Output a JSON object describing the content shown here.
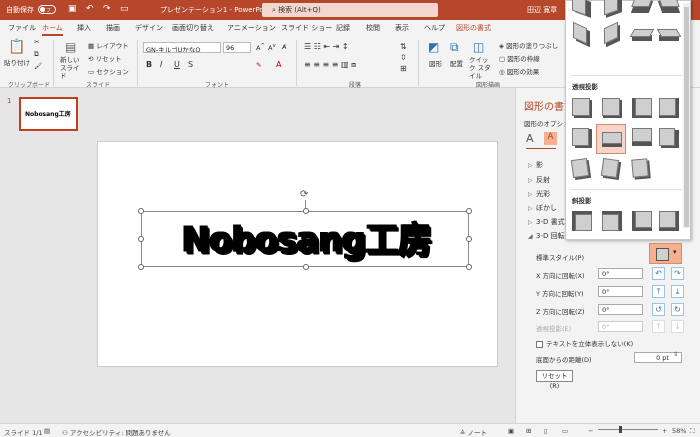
{
  "titlebar": {
    "autosave_label": "自動保存",
    "autosave_state": "オフ",
    "doc_title": "プレゼンテーション1 - PowerPoint",
    "search_placeholder": "検索 (Alt+Q)",
    "user_name": "田辺 寛章",
    "accent_color": "#b7472a"
  },
  "tabs": [
    "ファイル",
    "ホーム",
    "挿入",
    "描画",
    "デザイン",
    "画面切り替え",
    "アニメーション",
    "スライド ショー",
    "記録",
    "校閲",
    "表示",
    "ヘルプ",
    "図形の書式"
  ],
  "active_tab": "ホーム",
  "ribbon": {
    "clipboard": {
      "paste": "貼り付け",
      "group": "クリップボード"
    },
    "slides": {
      "new_slide": "新しい スライド",
      "layout": "レイアウト",
      "reset": "リセット",
      "section": "セクション",
      "group": "スライド"
    },
    "font": {
      "font_name": "GN-キルゴUかなO",
      "font_size": "96",
      "group": "フォント",
      "bold": "B",
      "italic": "I",
      "underline": "U",
      "strike": "S"
    },
    "paragraph": {
      "group": "段落"
    },
    "drawing": {
      "shapes": "図形",
      "arrange": "配置",
      "quick_styles": "クイック スタイル",
      "fill": "図形の塗りつぶし",
      "outline": "図形の枠線",
      "effects": "図形の効果",
      "group": "図形描画"
    }
  },
  "thumbnail": {
    "number": "1",
    "text": "Nobosang工房"
  },
  "slide": {
    "wordart_text": "Nobosang工房"
  },
  "format_pane": {
    "title": "図形の書式",
    "subtitle": "図形のオプション",
    "sections": [
      {
        "label": "影",
        "state": "collapsed"
      },
      {
        "label": "反射",
        "state": "collapsed"
      },
      {
        "label": "光彩",
        "state": "collapsed"
      },
      {
        "label": "ぼかし",
        "state": "collapsed"
      },
      {
        "label": "3-D 書式",
        "state": "collapsed"
      },
      {
        "label": "3-D 回転",
        "state": "expanded"
      }
    ],
    "preset_label": "標準スタイル(P)",
    "x_rotation": {
      "label": "X 方向に回転(X)",
      "value": "0°"
    },
    "y_rotation": {
      "label": "Y 方向に回転(Y)",
      "value": "0°"
    },
    "z_rotation": {
      "label": "Z 方向に回転(Z)",
      "value": "0°"
    },
    "perspective": {
      "label": "透視投影(E)",
      "value": "0°"
    },
    "keep_flat": "テキストを立体表示しない(K)",
    "distance": {
      "label": "底面からの距離(D)",
      "value": "0 pt"
    },
    "reset": "リセット(R)"
  },
  "gallery": {
    "perspective_header": "透視投影",
    "oblique_header": "斜投影"
  },
  "statusbar": {
    "slide": "スライド 1/1",
    "accessibility": "アクセシビリティ: 問題ありません",
    "notes": "ノート",
    "zoom": "58%"
  }
}
